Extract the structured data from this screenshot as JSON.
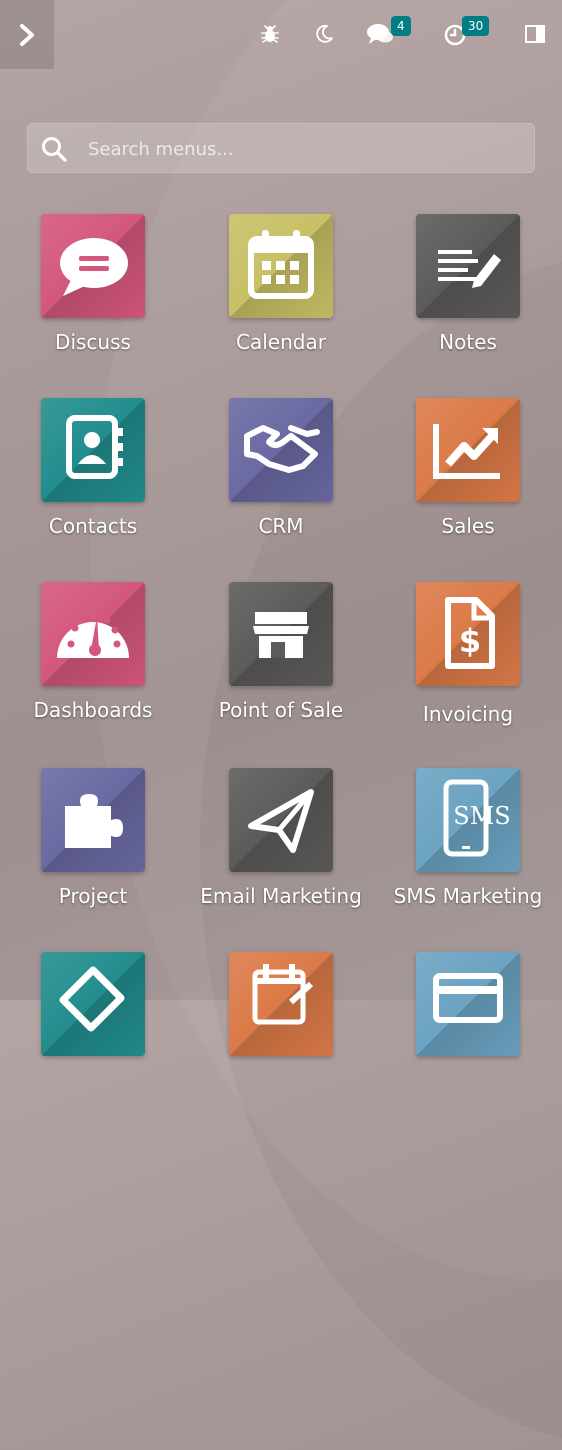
{
  "topbar": {
    "menu_toggle_icon": "chevron-right-icon",
    "debug_icon": "bug-icon",
    "theme_icon": "moon-icon",
    "messages_icon": "chat-bubbles-icon",
    "messages_count": "4",
    "activities_icon": "clock-icon",
    "activities_count": "30",
    "panel_icon": "sidebar-panel-icon"
  },
  "search": {
    "placeholder": "Search menus..."
  },
  "apps": [
    {
      "label": "Discuss",
      "icon": "speech-bubble-icon",
      "color": "#d4577d"
    },
    {
      "label": "Calendar",
      "icon": "calendar-icon",
      "color": "#c7c066"
    },
    {
      "label": "Notes",
      "icon": "notes-pencil-icon",
      "color": "#5c5b59"
    },
    {
      "label": "Contacts",
      "icon": "address-book-icon",
      "color": "#228d8d"
    },
    {
      "label": "CRM",
      "icon": "handshake-icon",
      "color": "#6a69a2"
    },
    {
      "label": "Sales",
      "icon": "trend-chart-icon",
      "color": "#db7a48"
    },
    {
      "label": "Dashboards",
      "icon": "gauge-icon",
      "color": "#d4577d"
    },
    {
      "label": "Point of Sale",
      "icon": "storefront-icon",
      "color": "#5c5b59"
    },
    {
      "label": "Invoicing",
      "icon": "invoice-dollar-icon",
      "color": "#db7a48"
    },
    {
      "label": "Project",
      "icon": "puzzle-icon",
      "color": "#6a69a2"
    },
    {
      "label": "Email Marketing",
      "icon": "paper-plane-icon",
      "color": "#5c5b59"
    },
    {
      "label": "SMS Marketing",
      "icon": "sms-phone-icon",
      "color": "#6ba3c2",
      "glyph_text": "SMS"
    },
    {
      "label": "",
      "icon": "tag-icon",
      "color": "#228d8d"
    },
    {
      "label": "",
      "icon": "calendar-edit-icon",
      "color": "#db7a48"
    },
    {
      "label": "",
      "icon": "card-icon",
      "color": "#6ba3c2"
    }
  ]
}
